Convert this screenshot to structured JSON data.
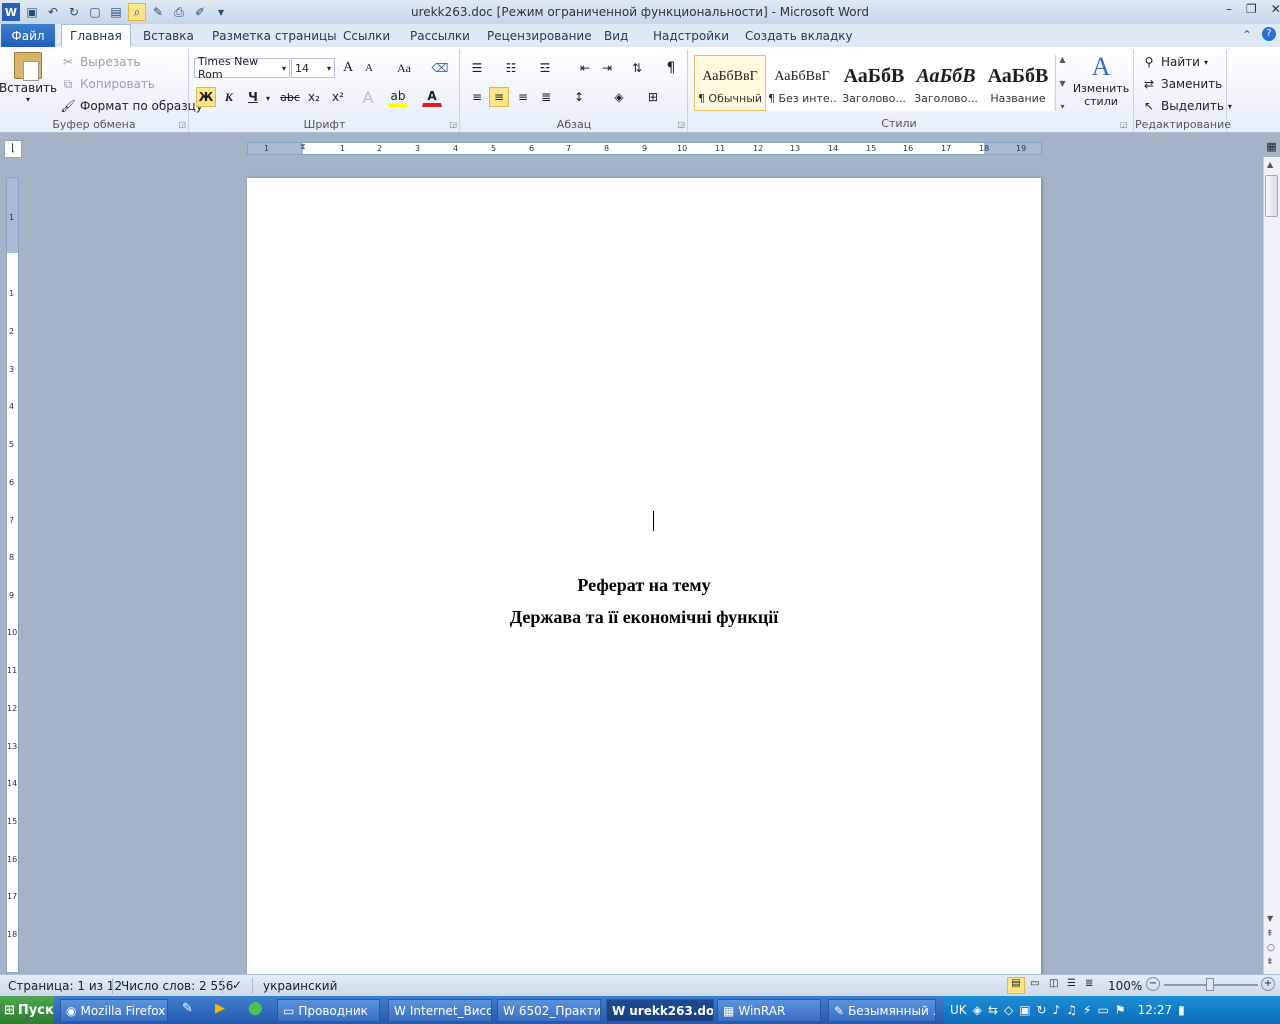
{
  "window": {
    "title": "urekk263.doc [Режим ограниченной функциональности]  -  Microsoft Word",
    "controls": [
      "–",
      "❐",
      "✕"
    ]
  },
  "qat": {
    "icons": [
      "word-icon",
      "save-icon",
      "undo-icon",
      "redo-icon",
      "new-icon",
      "open-icon",
      "print-preview-icon",
      "edit-icon",
      "print-icon",
      "draw-icon",
      "customize-icon"
    ]
  },
  "tabs": {
    "file": "Файл",
    "items": [
      "Главная",
      "Вставка",
      "Разметка страницы",
      "Ссылки",
      "Рассылки",
      "Рецензирование",
      "Вид",
      "Надстройки",
      "Создать вкладку"
    ]
  },
  "clipboard": {
    "paste": "Вставить",
    "cut": "Вырезать",
    "copy": "Копировать",
    "format_painter": "Формат по образцу",
    "label": "Буфер обмена"
  },
  "font": {
    "name": "Times New Rom",
    "size": "14",
    "label": "Шрифт",
    "bold": "Ж",
    "italic": "К",
    "underline": "Ч",
    "strike": "abc",
    "grow": "A",
    "case": "Aa"
  },
  "paragraph": {
    "label": "Абзац",
    "pilcrow": "¶"
  },
  "styles": {
    "label": "Стили",
    "items": [
      {
        "sample": "АаБбВвГ",
        "name": "¶ Обычный"
      },
      {
        "sample": "АаБбВвГ",
        "name": "¶ Без инте..."
      },
      {
        "sample": "АаБбВ",
        "name": "Заголово..."
      },
      {
        "sample": "АаБбВ",
        "name": "Заголово..."
      },
      {
        "sample": "АаБбВ",
        "name": "Название"
      }
    ],
    "change": "Изменить стили"
  },
  "editing": {
    "find": "Найти",
    "replace": "Заменить",
    "select": "Выделить",
    "label": "Редактирование"
  },
  "ruler": {
    "h": [
      "1",
      "1",
      "2",
      "3",
      "4",
      "5",
      "6",
      "7",
      "8",
      "9",
      "10",
      "11",
      "12",
      "13",
      "14",
      "15",
      "16",
      "17",
      "18",
      "19"
    ],
    "v": [
      "1",
      "1",
      "2",
      "3",
      "4",
      "5",
      "6",
      "7",
      "8",
      "9",
      "10",
      "11",
      "12",
      "13",
      "14",
      "15",
      "16",
      "17",
      "18"
    ]
  },
  "document": {
    "line1": "Реферат на тему",
    "line2": "Держава та її економічні функції"
  },
  "status": {
    "page": "Страница: 1 из 12",
    "words": "Число слов: 2 556",
    "lang": "украинский",
    "zoom": "100%"
  },
  "taskbar": {
    "start": "Пуск",
    "items": [
      {
        "label": "Mozilla Firefox",
        "active": false
      },
      {
        "label": "Проводник",
        "active": false
      },
      {
        "label": "Internet_Висо...",
        "active": false
      },
      {
        "label": "6502_Практи...",
        "active": false
      },
      {
        "label": "urekk263.do...",
        "active": true
      },
      {
        "label": "WinRAR",
        "active": false
      },
      {
        "label": "Безымянный ...",
        "active": false
      }
    ],
    "lang": "UK",
    "clock": "12:27"
  }
}
